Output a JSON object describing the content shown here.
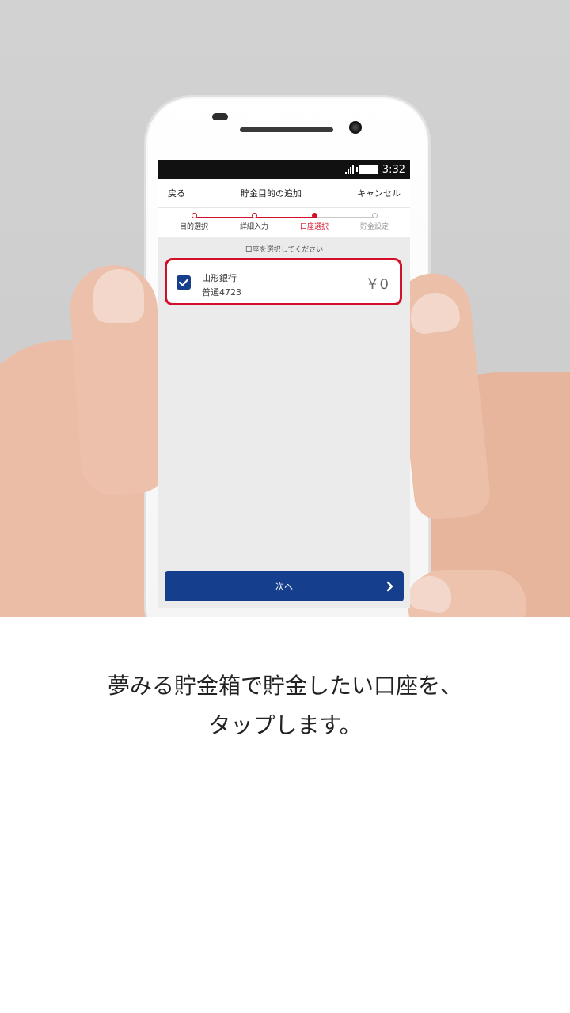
{
  "status_bar": {
    "time": "3:32"
  },
  "nav": {
    "back_label": "戻る",
    "title": "貯金目的の追加",
    "cancel_label": "キャンセル"
  },
  "steps": [
    {
      "label": "目的選択",
      "state": "done"
    },
    {
      "label": "詳細入力",
      "state": "done"
    },
    {
      "label": "口座選択",
      "state": "current"
    },
    {
      "label": "貯金設定",
      "state": "pending"
    }
  ],
  "instruction": "口座を選択してください",
  "account": {
    "bank_name": "山形銀行",
    "account_label": "普通4723",
    "balance": "￥0",
    "checked": true
  },
  "next_button_label": "次へ",
  "caption": {
    "line1": "夢みる貯金箱で貯金したい口座を、",
    "line2": "タップします。"
  },
  "colors": {
    "accent_red": "#d3102a",
    "primary_blue": "#153f8c",
    "pending_gray": "#b5b5b5"
  },
  "icons": [
    "signal-icon",
    "battery-icon",
    "checkmark-icon",
    "chevron-right-icon"
  ]
}
